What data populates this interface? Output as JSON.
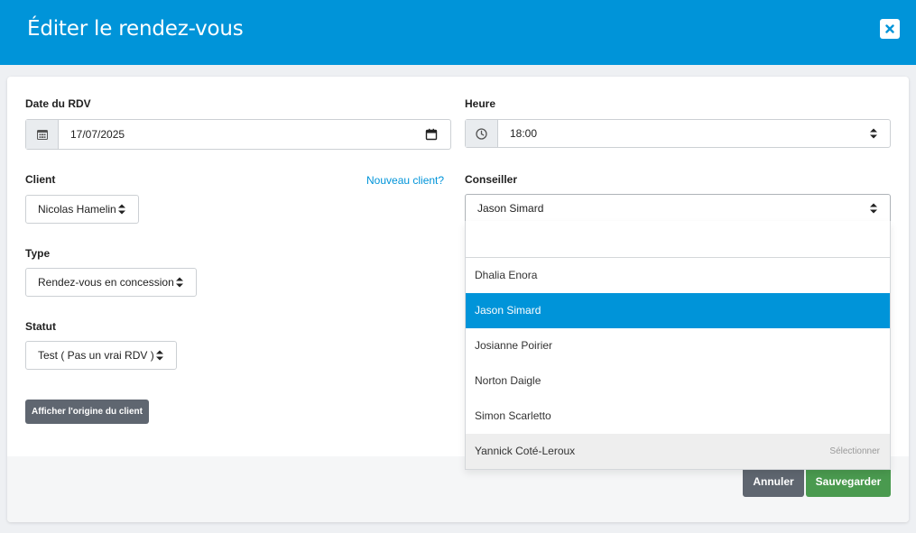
{
  "header": {
    "title": "Éditer le rendez-vous",
    "close_icon": "close-icon"
  },
  "form": {
    "date": {
      "label": "Date du RDV",
      "value": "17/07/2025",
      "addon_icon": "calendar-grid-icon",
      "trailing_icon": "calendar-icon"
    },
    "time": {
      "label": "Heure",
      "value": "18:00",
      "addon_icon": "clock-icon"
    },
    "client": {
      "label": "Client",
      "value": "Nicolas Hamelin",
      "new_link": "Nouveau client?"
    },
    "advisor": {
      "label": "Conseiller",
      "value": "Jason Simard"
    },
    "type": {
      "label": "Type",
      "value": "Rendez-vous en concession"
    },
    "status": {
      "label": "Statut",
      "value": "Test ( Pas un vrai RDV )"
    },
    "origin_button": "Afficher l'origine du client"
  },
  "dropdown": {
    "search_value": "",
    "options": [
      "Dhalia Enora",
      "Jason Simard",
      "Josianne Poirier",
      "Norton Daigle",
      "Simon Scarletto",
      "Yannick Coté-Leroux"
    ],
    "selected": "Jason Simard",
    "hovered": "Yannick Coté-Leroux",
    "hover_hint": "Sélectionner"
  },
  "footer": {
    "cancel_label": "Annuler",
    "save_label": "Sauvegarder"
  },
  "colors": {
    "header": "#0094d9",
    "selected": "#0094d9",
    "save": "#4a9a4f",
    "cancel": "#5f6670"
  }
}
